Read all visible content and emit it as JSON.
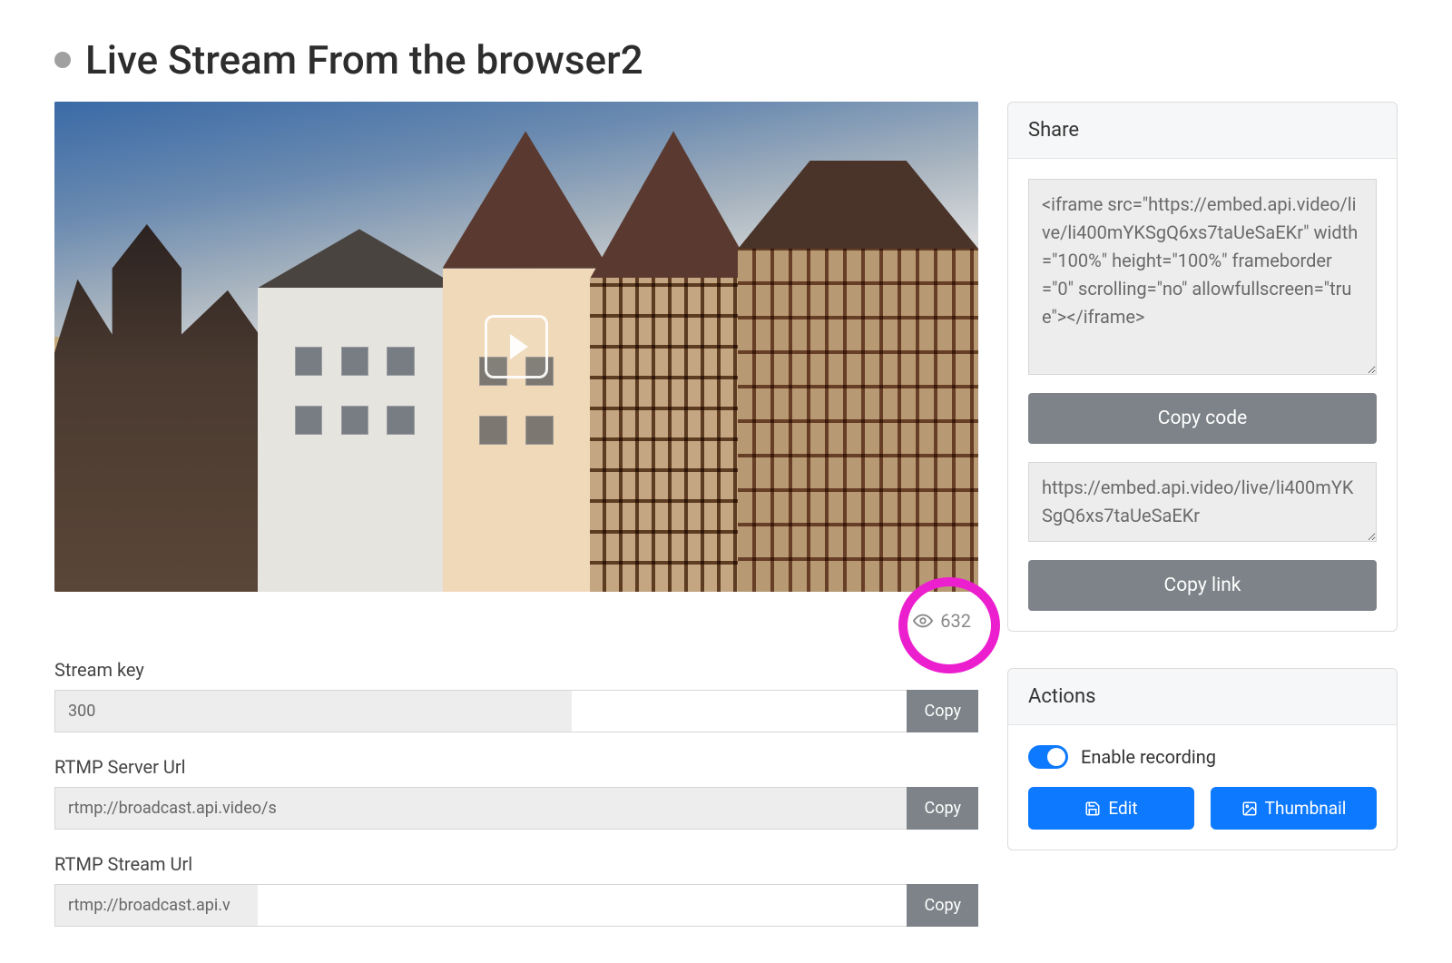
{
  "header": {
    "title": "Live Stream From the browser2",
    "status": "inactive"
  },
  "video": {
    "views": "632"
  },
  "fields": {
    "stream_key": {
      "label": "Stream key",
      "value": "300",
      "copy_label": "Copy"
    },
    "rtmp_server": {
      "label": "RTMP Server Url",
      "value": "rtmp://broadcast.api.video/s",
      "copy_label": "Copy"
    },
    "rtmp_stream": {
      "label": "RTMP Stream Url",
      "value": "rtmp://broadcast.api.v",
      "copy_label": "Copy"
    }
  },
  "share": {
    "title": "Share",
    "embed_code": "<iframe src=\"https://embed.api.video/live/li400mYKSgQ6xs7taUeSaEKr\" width=\"100%\" height=\"100%\" frameborder=\"0\" scrolling=\"no\" allowfullscreen=\"true\"></iframe>",
    "copy_code_label": "Copy code",
    "link": "https://embed.api.video/live/li400mYKSgQ6xs7taUeSaEKr",
    "copy_link_label": "Copy link"
  },
  "actions": {
    "title": "Actions",
    "recording_label": "Enable recording",
    "recording_enabled": true,
    "edit_label": "Edit",
    "thumbnail_label": "Thumbnail"
  }
}
